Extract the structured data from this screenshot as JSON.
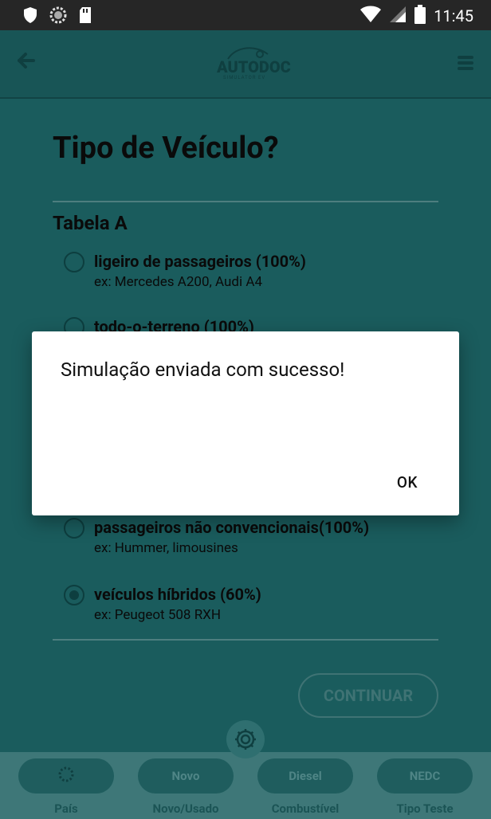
{
  "status_bar": {
    "time": "11:45"
  },
  "header": {
    "logo_text": "AUTODOC",
    "logo_sub": "SIMULATOR EV"
  },
  "main": {
    "title": "Tipo de Veículo?",
    "section_title": "Tabela A",
    "options": [
      {
        "label": "ligeiro de passageiros (100%)",
        "sub": "ex: Mercedes A200, Audi A4",
        "selected": false
      },
      {
        "label": "todo-o-terreno (100%)",
        "sub": "",
        "selected": false
      },
      {
        "label": "passageiros não convencionais(100%)",
        "sub": "ex: Hummer, limousines",
        "selected": false
      },
      {
        "label": "veículos híbridos (60%)",
        "sub": "ex: Peugeot 508 RXH",
        "selected": true
      }
    ],
    "continue_label": "CONTINUAR"
  },
  "bottom_nav": {
    "tabs": [
      {
        "pill": "",
        "label": "País"
      },
      {
        "pill": "Novo",
        "label": "Novo/Usado"
      },
      {
        "pill": "Diesel",
        "label": "Combustível"
      },
      {
        "pill": "NEDC",
        "label": "Tipo Teste"
      }
    ]
  },
  "dialog": {
    "message": "Simulação enviada com sucesso!",
    "ok_label": "OK"
  },
  "colors": {
    "background": "#1a5c5d",
    "header": "#185556",
    "bottom_bar": "#3e7778",
    "dialog": "#ffffff"
  }
}
